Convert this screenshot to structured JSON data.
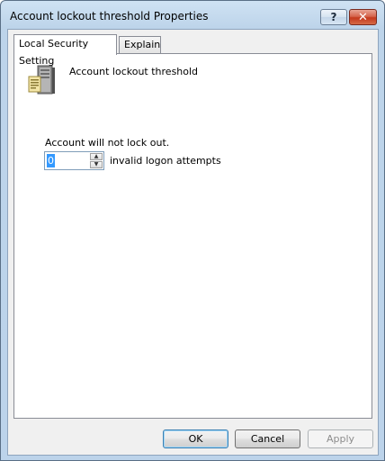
{
  "window": {
    "title": "Account lockout threshold Properties",
    "help_glyph": "?",
    "close_glyph": "✕"
  },
  "tabs": [
    {
      "label": "Local Security Setting",
      "active": true
    },
    {
      "label": "Explain",
      "active": false
    }
  ],
  "panel": {
    "policy_icon": "security-policy-icon",
    "policy_name": "Account lockout threshold",
    "status": "Account will not lock out.",
    "threshold": {
      "value": "0",
      "units_label": "invalid logon attempts"
    }
  },
  "buttons": {
    "ok": "OK",
    "cancel": "Cancel",
    "apply": "Apply"
  },
  "colors": {
    "frame": "#bcd3ea",
    "close": "#c4391d",
    "selection": "#3399ff"
  }
}
